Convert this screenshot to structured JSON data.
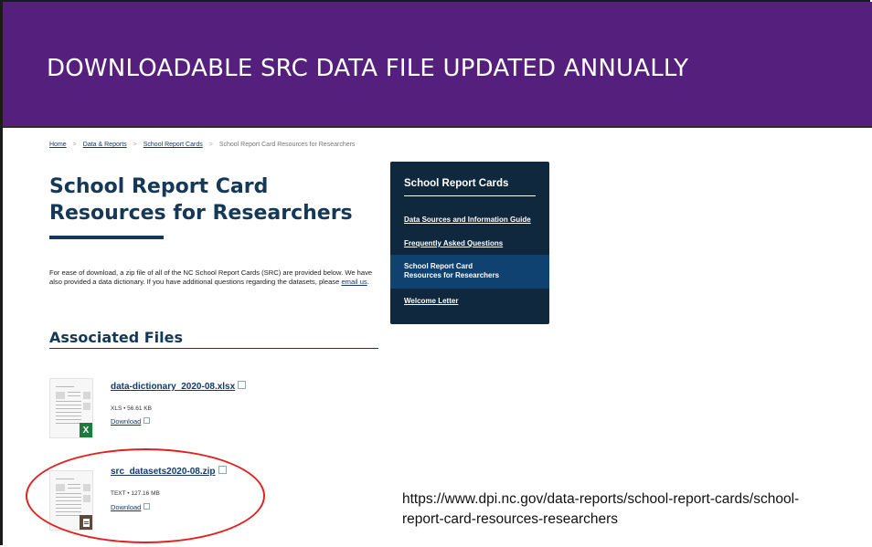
{
  "slide": {
    "title": "DOWNLOADABLE SRC DATA FILE UPDATED ANNUALLY",
    "url_caption": "https://www.dpi.nc.gov/data-reports/school-report-cards/school-report-card-resources-researchers",
    "header_color": "#55207d"
  },
  "breadcrumb": {
    "home": "Home",
    "data_reports": "Data & Reports",
    "school_report_cards": "School Report Cards",
    "current": "School Report Card Resources for Researchers"
  },
  "page": {
    "title": "School Report Card Resources for Researchers",
    "intro_text": "For ease of download, a zip file of all of the NC School Report Cards (SRC) are provided below. We have also provided a data dictionary. If you have additional questions regarding the datasets, please",
    "intro_link": "email us",
    "intro_end": ".",
    "associated_files_heading": "Associated Files"
  },
  "files": [
    {
      "name": "data-dictionary_2020-08.xlsx",
      "meta": "XLS • 56.61 KB",
      "download": "Download",
      "badge": "X",
      "icon": "excel-file-icon"
    },
    {
      "name": "src_datasets2020-08.zip",
      "meta": "TEXT • 127.16 MB",
      "download": "Download",
      "badge": "",
      "icon": "text-file-icon"
    }
  ],
  "sidebar": {
    "title": "School Report Cards",
    "items": [
      {
        "label": "Data Sources and Information Guide"
      },
      {
        "label": "Frequently Asked Questions"
      },
      {
        "label": "School Report Card Resources for Researchers",
        "active": true
      },
      {
        "label": "Welcome Letter"
      }
    ]
  }
}
